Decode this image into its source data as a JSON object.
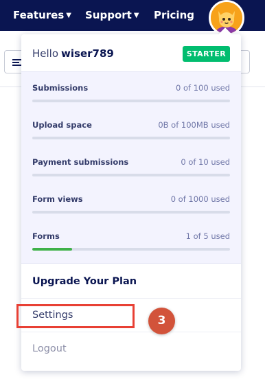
{
  "nav": {
    "features_label": "Features",
    "support_label": "Support",
    "pricing_label": "Pricing"
  },
  "account": {
    "greeting": "Hello",
    "username": "wiser789",
    "plan": "STARTER"
  },
  "usage": [
    {
      "label": "Submissions",
      "value": "0 of 100 used",
      "fraction": 0,
      "color": "#d8dce9"
    },
    {
      "label": "Upload space",
      "value": "0B of 100MB used",
      "fraction": 0,
      "color": "#d8dce9"
    },
    {
      "label": "Payment submissions",
      "value": "0 of 10 used",
      "fraction": 0,
      "color": "#d8dce9"
    },
    {
      "label": "Form views",
      "value": "0 of 1000 used",
      "fraction": 0,
      "color": "#d8dce9"
    },
    {
      "label": "Forms",
      "value": "1 of 5 used",
      "fraction": 0.2,
      "color": "#3fb149"
    }
  ],
  "menu": {
    "upgrade_label": "Upgrade Your Plan",
    "settings_label": "Settings",
    "logout_label": "Logout"
  },
  "annotation": {
    "step_number": "3"
  },
  "colors": {
    "navbar": "#0a1551",
    "plan_badge": "#01bd6f",
    "highlight": "#e84034",
    "step_badge": "#d2533a"
  },
  "icons": {
    "caret": "caret-down-icon",
    "avatar": "cat-avatar-icon",
    "toolbar": "filter-lines-icon"
  }
}
